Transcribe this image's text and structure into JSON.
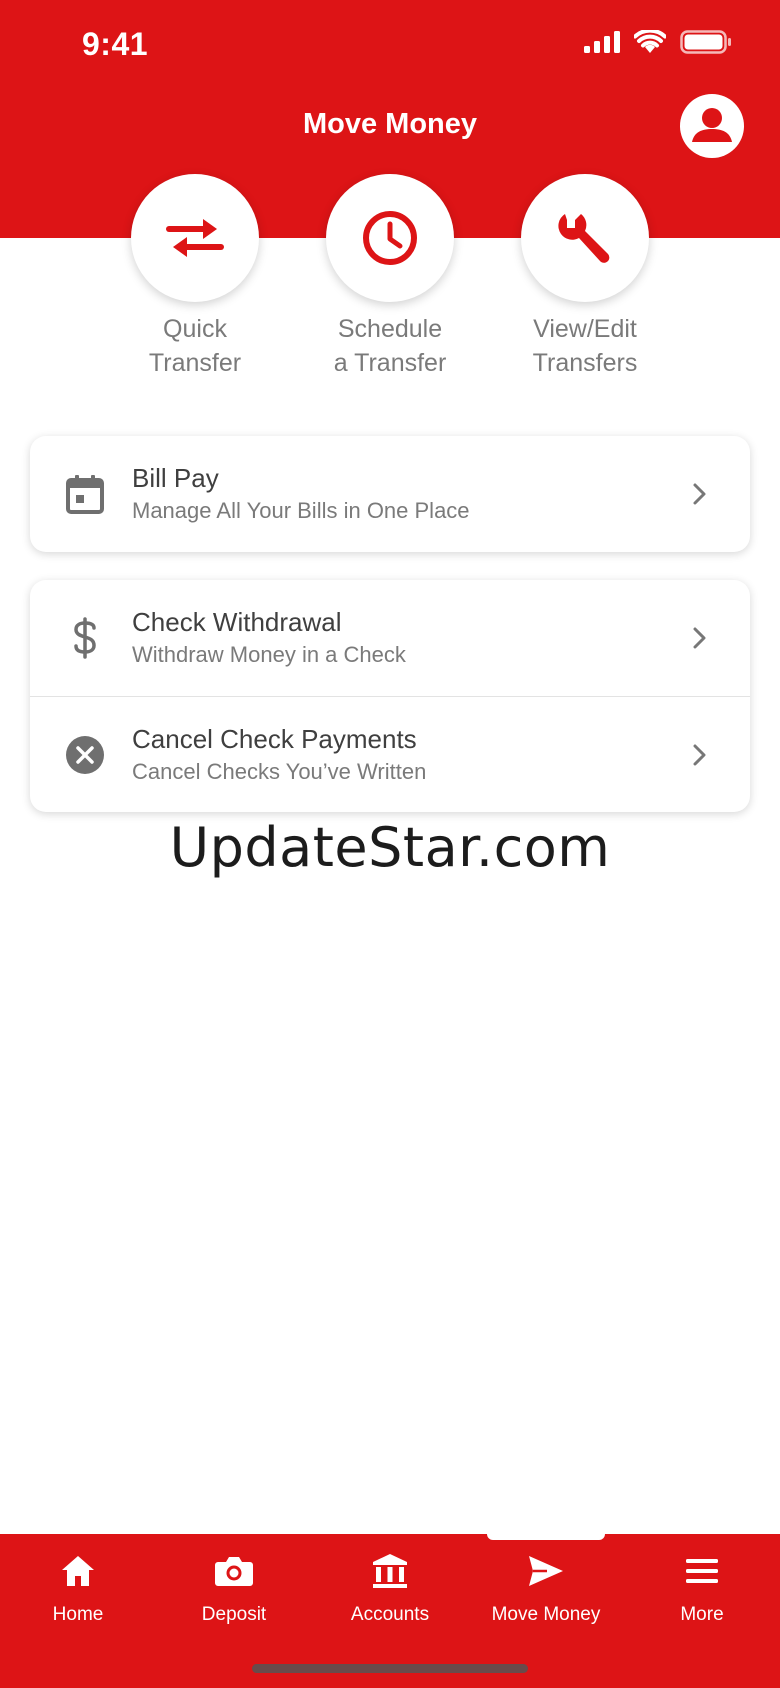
{
  "status_bar": {
    "time": "9:41"
  },
  "header": {
    "title": "Move Money"
  },
  "quick_actions": [
    {
      "label": "Quick\nTransfer",
      "icon": "swap-arrows-icon"
    },
    {
      "label": "Schedule\na Transfer",
      "icon": "clock-icon"
    },
    {
      "label": "View/Edit\nTransfers",
      "icon": "wrench-icon"
    }
  ],
  "bill_pay": {
    "title": "Bill Pay",
    "subtitle": "Manage All Your Bills in One Place",
    "icon": "calendar-icon"
  },
  "check_withdrawal": {
    "title": "Check Withdrawal",
    "subtitle": "Withdraw Money in a Check",
    "icon": "dollar-icon"
  },
  "cancel_check": {
    "title": "Cancel Check Payments",
    "subtitle": "Cancel Checks You’ve Written",
    "icon": "cancel-circle-icon"
  },
  "watermark": "UpdateStar.com",
  "tabs": [
    {
      "label": "Home",
      "icon": "home-icon"
    },
    {
      "label": "Deposit",
      "icon": "camera-icon"
    },
    {
      "label": "Accounts",
      "icon": "bank-icon"
    },
    {
      "label": "Move Money",
      "icon": "send-icon",
      "active": true
    },
    {
      "label": "More",
      "icon": "menu-icon"
    }
  ],
  "colors": {
    "brand_red": "#dd1416",
    "text_dark": "#3f3f3f",
    "text_muted": "#7a7a7a"
  }
}
